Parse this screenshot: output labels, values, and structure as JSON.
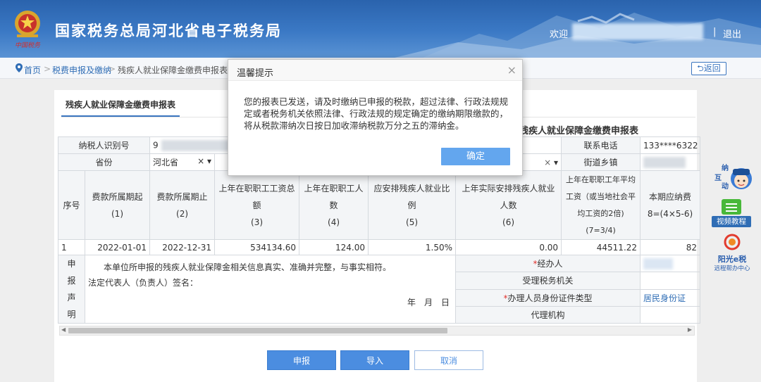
{
  "header": {
    "site_title": "国家税务总局河北省电子税务局",
    "welcome": "欢迎",
    "separator": "|",
    "logout": "退出"
  },
  "breadcrumb": {
    "home": "首页",
    "level1": "税费申报及缴纳",
    "level2": "残疾人就业保障金缴费申报表",
    "arrow": ">",
    "back": "返回"
  },
  "tab": {
    "label": "残疾人就业保障金缴费申报表"
  },
  "form": {
    "title": "残疾人就业保障金缴费申报表",
    "taxpayer_id_label": "纳税人识别号",
    "taxpayer_id_value_start": "9",
    "phone_label": "联系电话",
    "phone_value": "133****6322",
    "province_label": "省份",
    "province_value": "河北省",
    "clear_mark": "×",
    "dropdown_mark": "▾",
    "street_label": "街道乡镇",
    "columns": [
      {
        "title": "序号",
        "num": ""
      },
      {
        "title": "费款所属期起",
        "num": "(1)"
      },
      {
        "title": "费款所属期止",
        "num": "(2)"
      },
      {
        "title": "上年在职职工工资总额",
        "num": "(3)"
      },
      {
        "title": "上年在职职工人数",
        "num": "(4)"
      },
      {
        "title": "应安排残疾人就业比例",
        "num": "(5)"
      },
      {
        "title": "上年实际安排残疾人就业人数",
        "num": "(6)"
      },
      {
        "title": "上年在职职工年平均工资（或当地社会平均工资的2倍)",
        "num": "(7=3/4)"
      },
      {
        "title": "本期应纳费",
        "num": "8=(4×5-6)"
      }
    ],
    "row": {
      "seq": "1",
      "start": "2022-01-01",
      "end": "2022-12-31",
      "wage_total": "534134.60",
      "staff_count": "124.00",
      "ratio": "1.50%",
      "disabled_count": "0.00",
      "avg_wage": "44511.22",
      "payable": "82"
    },
    "declaration": {
      "side_label": [
        "申",
        "报",
        "声",
        "明"
      ],
      "statement": "本单位所申报的残疾人就业保障金相关信息真实、准确并完整，与事实相符。",
      "signature": "法定代表人（负责人）签名：",
      "date": "年　月　日",
      "operator_label": "经办人",
      "required_mark": "*",
      "tax_office_label": "受理税务机关",
      "id_type_label": "办理人员身份证件类型",
      "id_type_value": "居民身份证",
      "agency_label": "代理机构"
    }
  },
  "buttons": {
    "submit": "申报",
    "import": "导入",
    "cancel": "取消"
  },
  "dialog": {
    "title": "温馨提示",
    "close": "×",
    "message": "您的报表已发送，请及时缴纳已申报的税款，超过法律、行政法规规定或者税务机关依照法律、行政法规的规定确定的缴纳期限缴款的，将从税款滞纳次日按日加收滞纳税款万分之五的滞纳金。",
    "ok": "确定"
  },
  "side_widgets": {
    "interact_text": "纳税互动",
    "video_label": "视频教程",
    "remote_title": "阳光e税",
    "remote_sub": "远程帮办中心"
  },
  "colors": {
    "brand_blue": "#2f6db5",
    "button_blue": "#4b8de0",
    "ok_button": "#63a6ee",
    "required_red": "#e0322d"
  }
}
